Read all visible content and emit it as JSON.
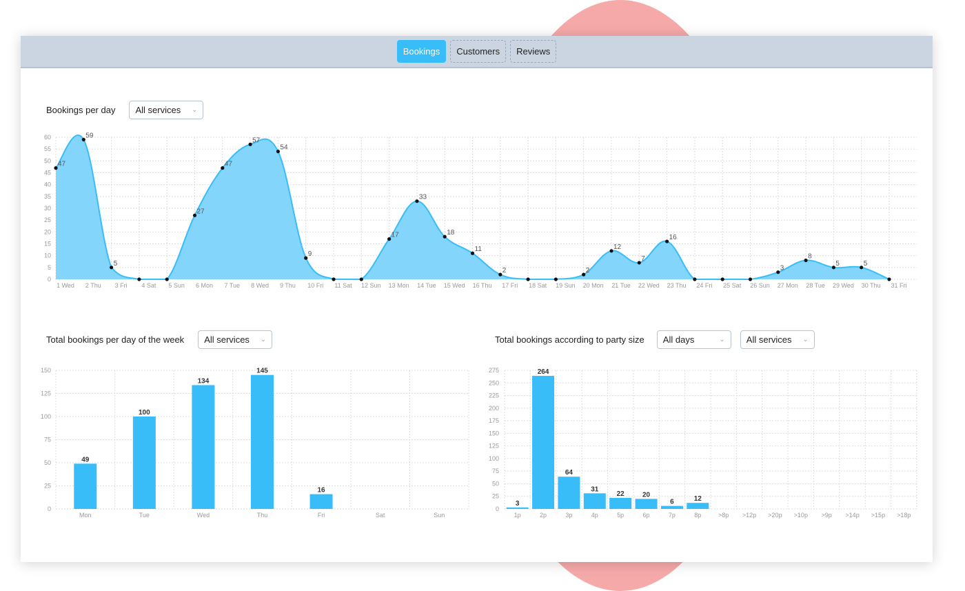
{
  "tabs": [
    {
      "label": "Bookings",
      "active": true
    },
    {
      "label": "Customers",
      "active": false
    },
    {
      "label": "Reviews",
      "active": false
    }
  ],
  "colors": {
    "accent": "#38bdf8",
    "area_fill": "#7dd3fc",
    "line": "#38bdf8",
    "point": "#111111",
    "grid": "#dddddd",
    "tick_text": "#999999",
    "label_text": "#555555"
  },
  "sections": {
    "daily": {
      "title": "Bookings per day",
      "filter": "All services"
    },
    "weekday": {
      "title": "Total bookings per day of the week",
      "filter": "All services"
    },
    "party": {
      "title": "Total bookings according to party size",
      "filter_days": "All days",
      "filter_services": "All services"
    }
  },
  "chart_data": [
    {
      "type": "area",
      "title": "Bookings per day",
      "xlabel": "",
      "ylabel": "",
      "ylim": [
        0,
        60
      ],
      "yticks": [
        0,
        5,
        10,
        15,
        20,
        25,
        30,
        35,
        40,
        45,
        50,
        55,
        60
      ],
      "grid": true,
      "categories": [
        "1 Wed",
        "2 Thu",
        "3 Fri",
        "4 Sat",
        "5 Sun",
        "6 Mon",
        "7 Tue",
        "8 Wed",
        "9 Thu",
        "10 Fri",
        "11 Sat",
        "12 Sun",
        "13 Mon",
        "14 Tue",
        "15 Wed",
        "16 Thu",
        "17 Fri",
        "18 Sat",
        "19 Sun",
        "20 Mon",
        "21 Tue",
        "22 Wed",
        "23 Thu",
        "24 Fri",
        "25 Sat",
        "26 Sun",
        "27 Mon",
        "28 Tue",
        "29 Wed",
        "30 Thu",
        "31 Fri"
      ],
      "values": [
        47,
        59,
        5,
        0,
        0,
        27,
        47,
        57,
        54,
        9,
        0,
        0,
        17,
        33,
        18,
        11,
        2,
        0,
        0,
        2,
        12,
        7,
        16,
        0,
        0,
        0,
        3,
        8,
        5,
        5,
        0
      ]
    },
    {
      "type": "bar",
      "title": "Total bookings per day of the week",
      "xlabel": "",
      "ylabel": "",
      "ylim": [
        0,
        150
      ],
      "yticks": [
        0,
        25,
        50,
        75,
        100,
        125,
        150
      ],
      "grid": true,
      "categories": [
        "Mon",
        "Tue",
        "Wed",
        "Thu",
        "Fri",
        "Sat",
        "Sun"
      ],
      "values": [
        49,
        100,
        134,
        145,
        16,
        null,
        null
      ]
    },
    {
      "type": "bar",
      "title": "Total bookings according to party size",
      "xlabel": "",
      "ylabel": "",
      "ylim": [
        0,
        275
      ],
      "yticks": [
        0,
        25,
        50,
        75,
        100,
        125,
        150,
        175,
        200,
        225,
        250,
        275
      ],
      "grid": true,
      "categories": [
        "1p",
        "2p",
        "3p",
        "4p",
        "5p",
        "6p",
        "7p",
        "8p",
        ">8p",
        ">12p",
        ">20p",
        ">10p",
        ">9p",
        ">14p",
        ">15p",
        ">18p"
      ],
      "values": [
        3,
        264,
        64,
        31,
        22,
        20,
        6,
        12,
        null,
        null,
        null,
        null,
        null,
        null,
        null,
        null
      ]
    }
  ]
}
